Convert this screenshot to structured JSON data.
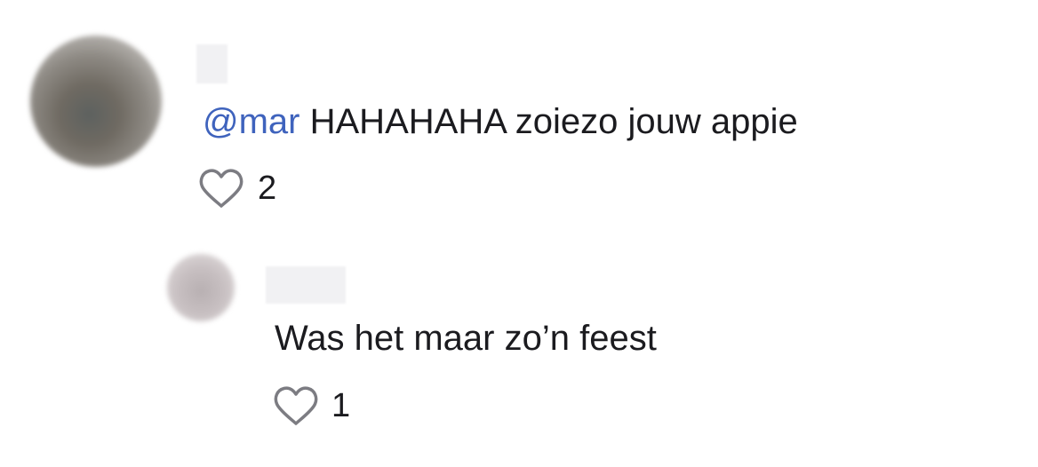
{
  "comments": {
    "main": {
      "mention": "@mar",
      "text": " HAHAHAHA zoiezo jouw appie",
      "likes": "2"
    },
    "reply": {
      "text": "Was het maar zo’n feest",
      "likes": "1"
    }
  },
  "icons": {
    "like": "heart-icon"
  }
}
